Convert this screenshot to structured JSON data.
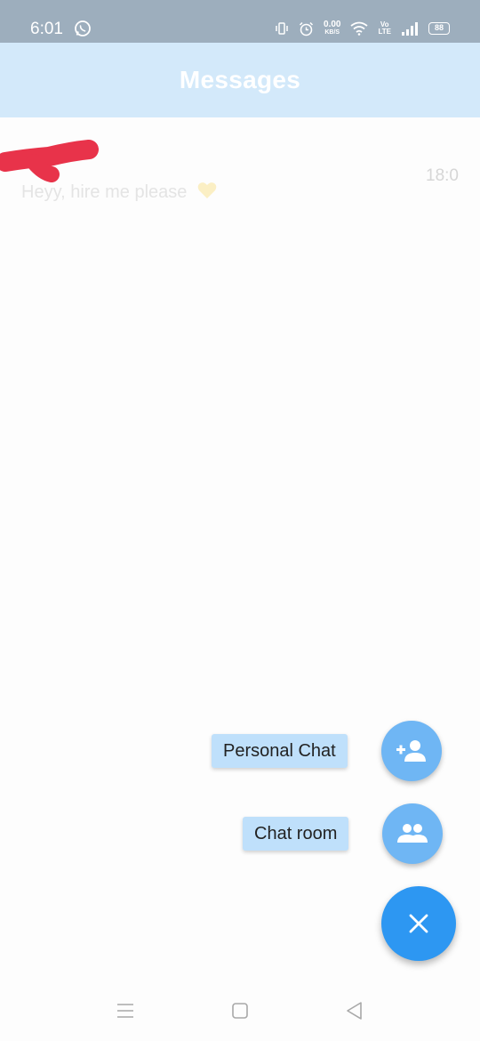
{
  "status_bar": {
    "time": "6:01",
    "net_speed": "0.00",
    "net_unit": "KB/S",
    "volte": "Vo",
    "lte": "LTE",
    "battery": "88",
    "icons": [
      "whatsapp-icon",
      "vibrate-icon",
      "alarm-icon",
      "wifi-icon",
      "signal-icon",
      "battery-icon"
    ]
  },
  "app_bar": {
    "title": "Messages"
  },
  "conversations": [
    {
      "preview": "Heyy, hire me please",
      "time": "18:0",
      "emoji": "yellow-heart-icon"
    }
  ],
  "fab_menu": {
    "personal_chat_label": "Personal Chat",
    "chat_room_label": "Chat room",
    "personal_chat_icon": "add-person-icon",
    "chat_room_icon": "group-icon",
    "close_icon": "close-icon"
  },
  "nav_bar": {
    "icons": [
      "menu-icon",
      "home-icon",
      "back-icon"
    ]
  },
  "colors": {
    "status_bar": "#9daebd",
    "app_bar": "#d3e9fa",
    "mini_fab": "#6fb6f4",
    "main_fab": "#2d97f2",
    "fab_label_bg": "#bfe0fb",
    "redaction": "#e8334a"
  }
}
